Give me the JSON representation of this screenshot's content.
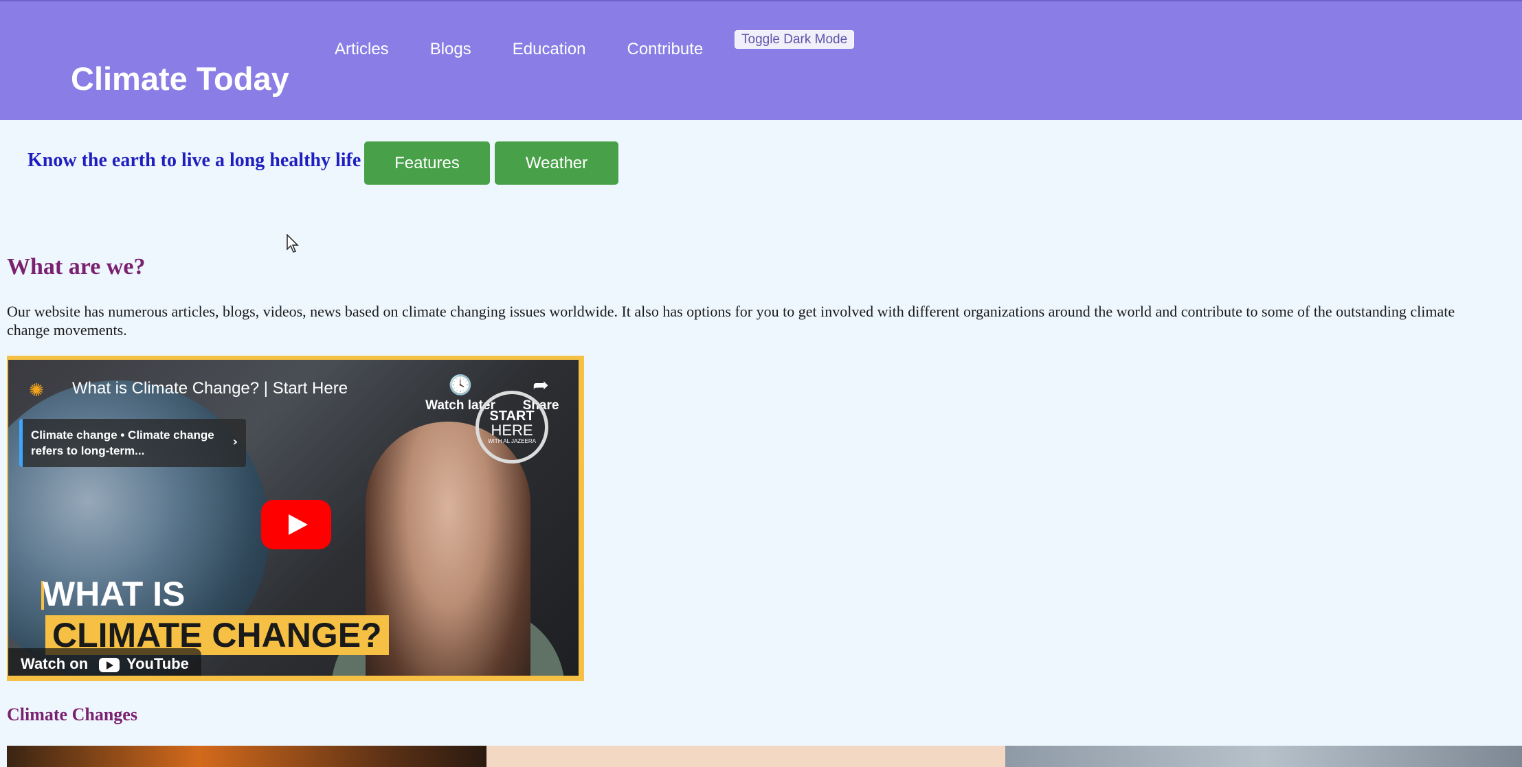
{
  "header": {
    "title": "Climate Today",
    "nav": [
      "Articles",
      "Blogs",
      "Education",
      "Contribute"
    ],
    "toggle_label": "Toggle Dark Mode"
  },
  "hero": {
    "tagline": "Know the earth to live a long healthy life",
    "buttons": [
      "Features",
      "Weather"
    ]
  },
  "about": {
    "heading": "What are we?",
    "text": "Our website has numerous articles, blogs, videos, news based on climate changing issues worldwide. It also has options for you to get involved with different organizations around the world and contribute to some of the outstanding climate change movements."
  },
  "video": {
    "title": "What is Climate Change? | Start Here",
    "watch_later": "Watch later",
    "share": "Share",
    "stamp_line1": "START",
    "stamp_line2": "HERE",
    "stamp_line3": "WITH AL JAZEERA",
    "chapter_text": "Climate change • Climate change refers to long-term...",
    "overlay_line1": "WHAT IS",
    "overlay_line2": "CLIMATE CHANGE?",
    "watch_on": "Watch on",
    "youtube": "YouTube"
  },
  "climate_changes": {
    "heading": "Climate Changes"
  },
  "colors": {
    "header_bg": "#8a7de6",
    "page_bg": "#eef7fe",
    "button_green": "#48a049",
    "heading_purple": "#7a2270",
    "tagline_blue": "#1f1fbf",
    "video_border": "#f5c043"
  }
}
